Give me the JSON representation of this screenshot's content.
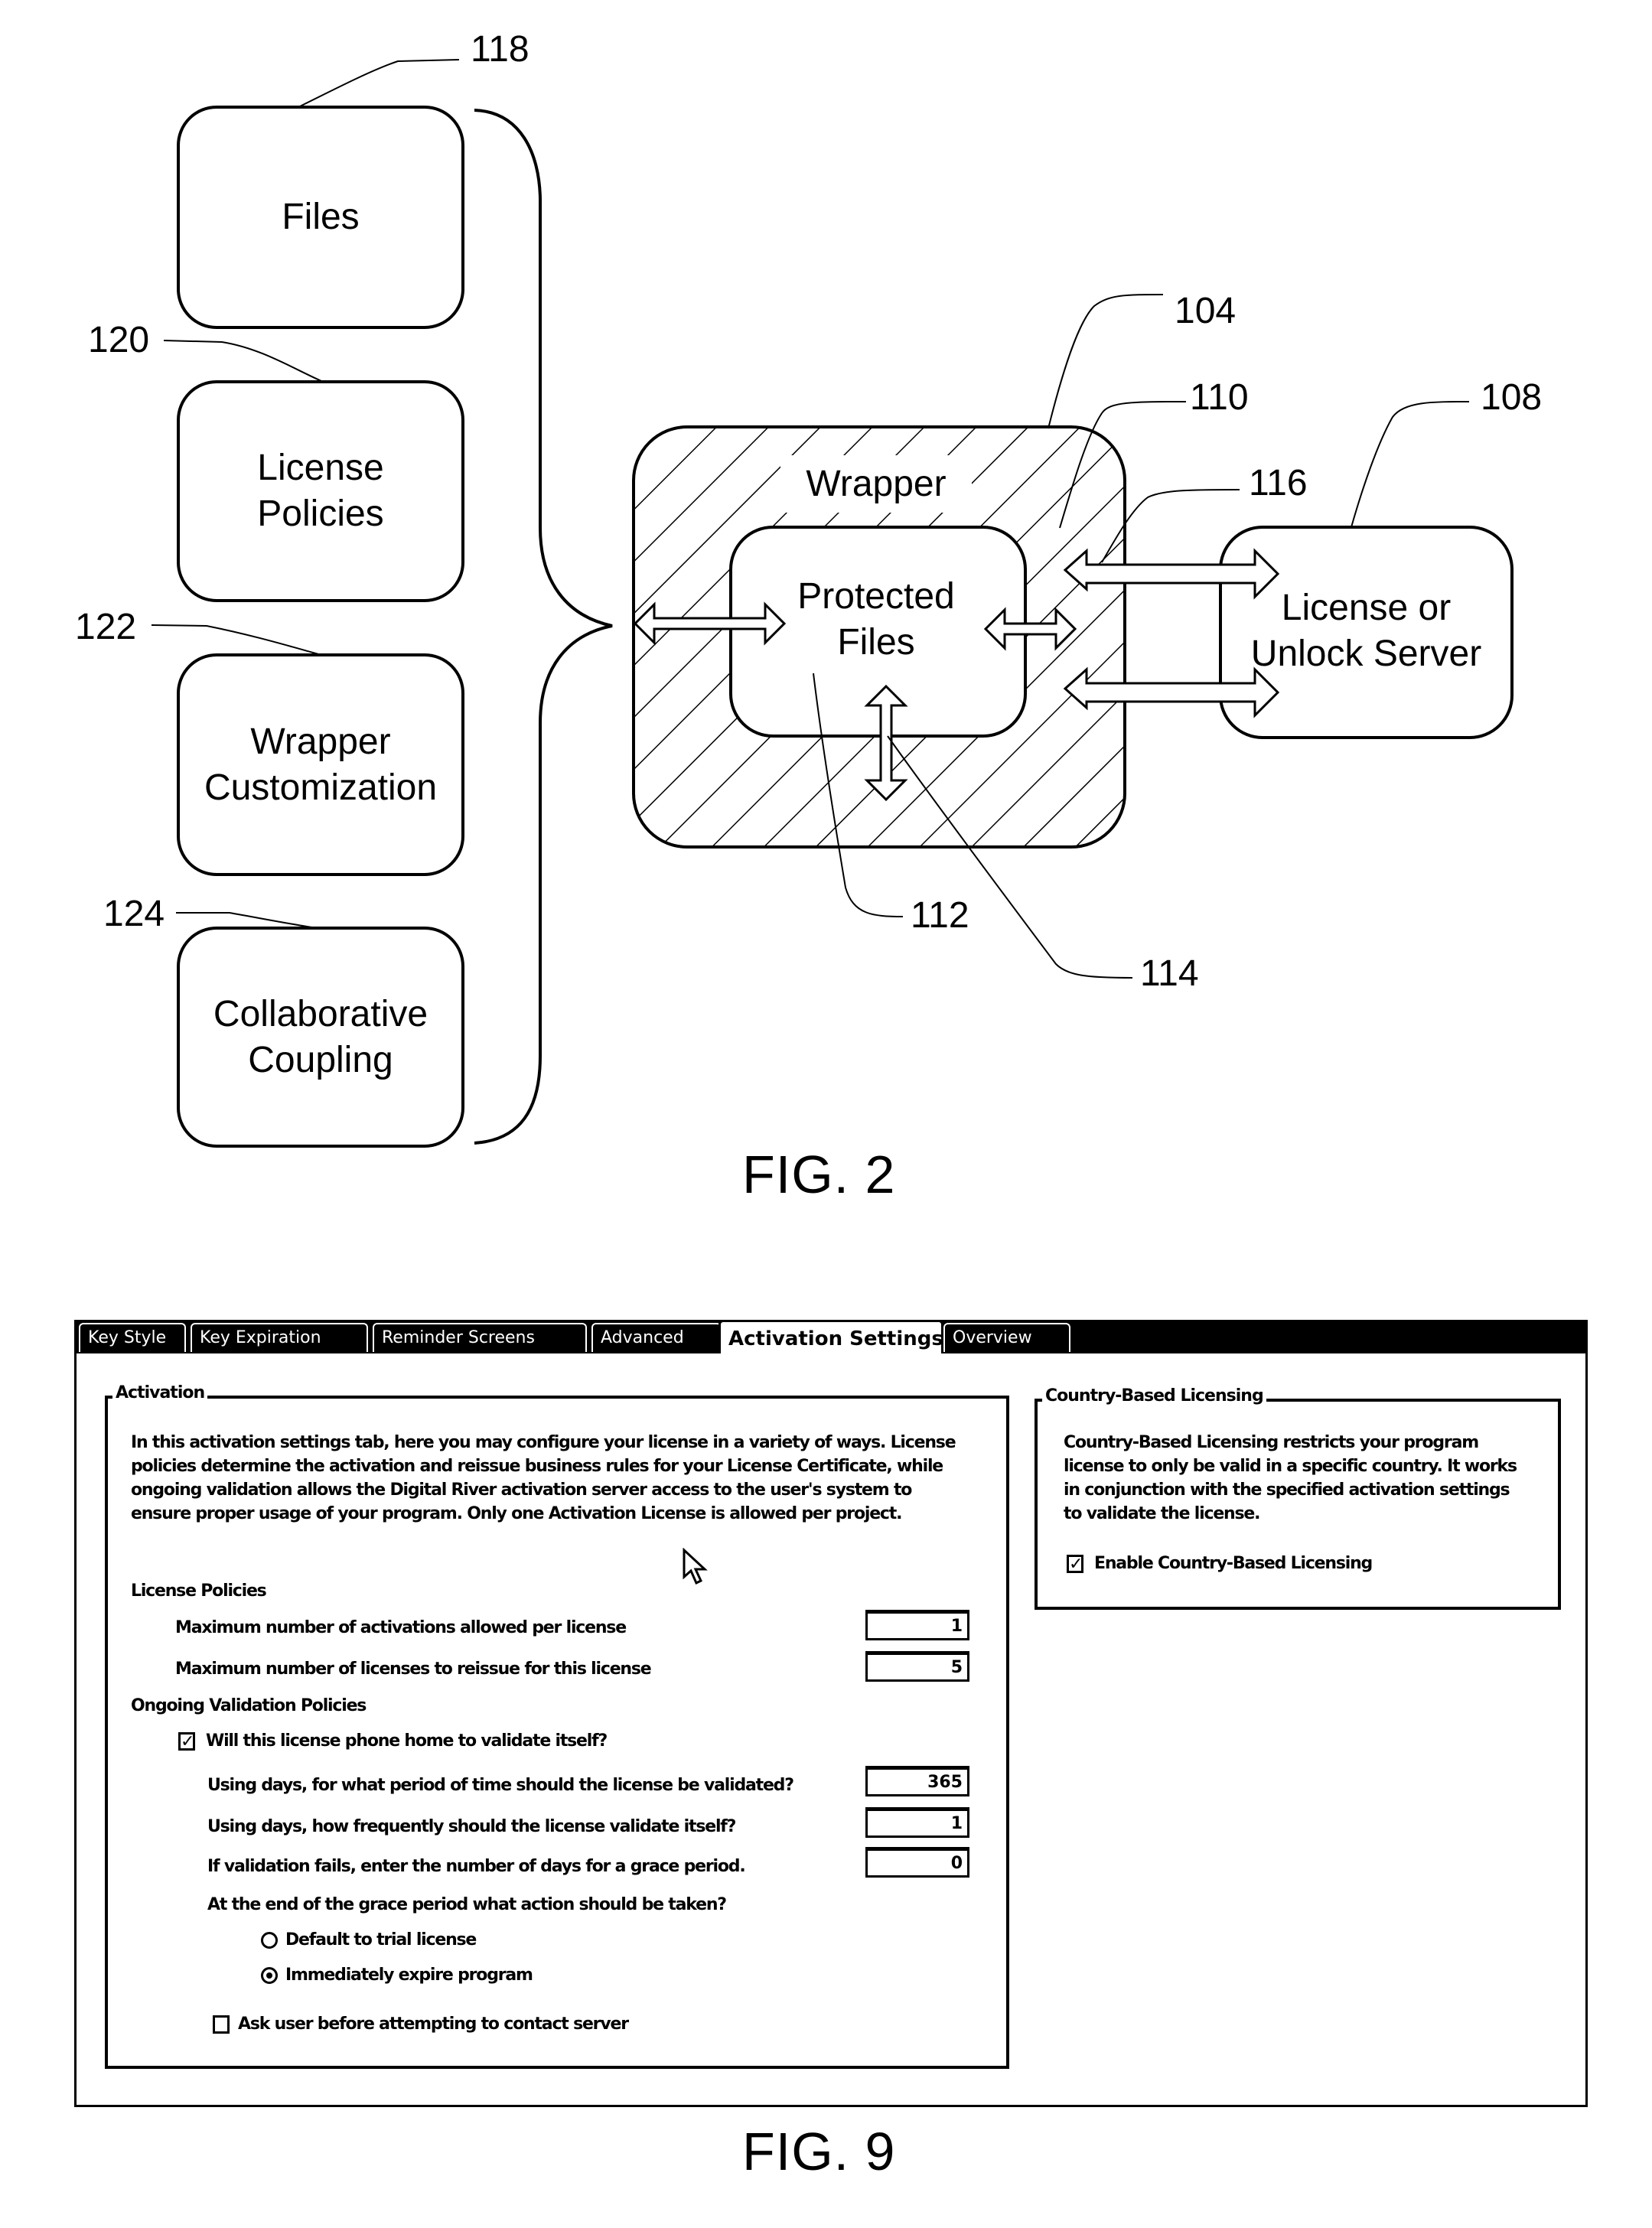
{
  "fig2": {
    "caption": "FIG. 2",
    "components": [
      {
        "ref": "118",
        "label": "Files"
      },
      {
        "ref": "120",
        "label": "License\nPolicies"
      },
      {
        "ref": "122",
        "label": "Wrapper\nCustomization"
      },
      {
        "ref": "124",
        "label": "Collaborative\nCoupling"
      }
    ],
    "wrapper": {
      "ref": "104",
      "label": "Wrapper",
      "hatch_ref": "110"
    },
    "protected_files": {
      "ref": "112",
      "label": "Protected\nFiles"
    },
    "arrow_ref_vertical": "114",
    "arrow_ref_server": "116",
    "server": {
      "ref": "108",
      "label": "License or\nUnlock Server"
    }
  },
  "fig9": {
    "caption": "FIG. 9",
    "tabs": [
      {
        "label": "Key Style",
        "active": false
      },
      {
        "label": "Key Expiration",
        "active": false
      },
      {
        "label": "Reminder Screens",
        "active": false
      },
      {
        "label": "Advanced",
        "active": false
      },
      {
        "label": "Activation Settings",
        "active": true
      },
      {
        "label": "Overview",
        "active": false
      }
    ],
    "activation": {
      "title": "Activation",
      "description": "In this activation settings tab, here you may configure your license in a variety of ways. License policies determine the activation and reissue business rules for your License Certificate, while ongoing validation allows the Digital River activation server access to the user's system to ensure proper usage of your program.  Only one Activation License is allowed per project.",
      "license_policies_heading": "License Policies",
      "max_activations_label": "Maximum number of activations allowed per license",
      "max_activations_value": "1",
      "max_reissue_label": "Maximum number of licenses to reissue for this license",
      "max_reissue_value": "5",
      "ongoing_heading": "Ongoing Validation Policies",
      "phone_home_label": "Will this license phone home to validate itself?",
      "phone_home_checked": true,
      "period_label": "Using days, for what period of time should the license be validated?",
      "period_value": "365",
      "frequency_label": "Using days, how frequently should the license validate itself?",
      "frequency_value": "1",
      "grace_label": "If validation fails, enter the number of days for a grace period.",
      "grace_value": "0",
      "end_action_question": "At the end of the grace period what action should be taken?",
      "end_action_options": [
        {
          "label": "Default to trial license",
          "selected": false
        },
        {
          "label": "Immediately expire program",
          "selected": true
        }
      ],
      "ask_user_label": "Ask user before attempting to contact server",
      "ask_user_checked": false
    },
    "country": {
      "title": "Country-Based Licensing",
      "description": "Country-Based Licensing restricts your program license to only be valid in a specific country.  It works in conjunction with the specified activation settings to validate the license.",
      "enable_label": "Enable Country-Based Licensing",
      "enable_checked": true
    },
    "check_glyph": "✓"
  }
}
